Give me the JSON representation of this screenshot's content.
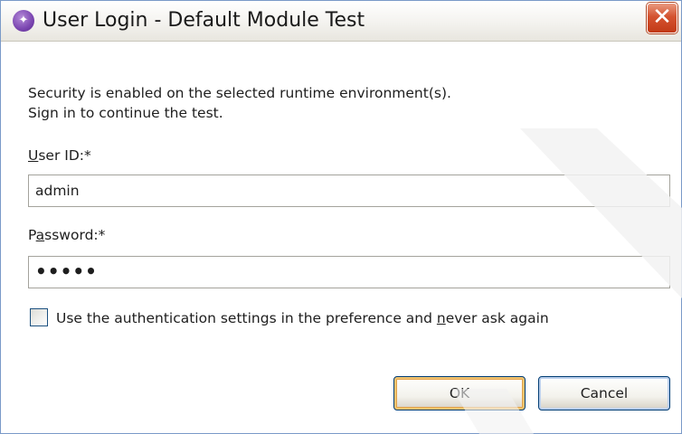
{
  "window": {
    "title": "User Login - Default Module Test",
    "close_glyph": "✕",
    "app_icon": "app-icon"
  },
  "message": {
    "line1": "Security is enabled on the selected runtime environment(s).",
    "line2": "Sign in to continue the test."
  },
  "user_id": {
    "label_u": "U",
    "label_rest": "ser ID:*",
    "value": "admin"
  },
  "password": {
    "label_pre": "P",
    "label_u": "a",
    "label_rest": "ssword:*",
    "masked_value": "•••••"
  },
  "remember": {
    "checked": false,
    "label_pre": "Use the authentication settings in the preference and ",
    "label_u": "n",
    "label_rest": "ever ask again"
  },
  "buttons": {
    "ok": "OK",
    "cancel": "Cancel"
  },
  "colors": {
    "accent_close": "#c23a17",
    "ok_focus": "#e5a34a",
    "border": "#7a9ac8"
  }
}
